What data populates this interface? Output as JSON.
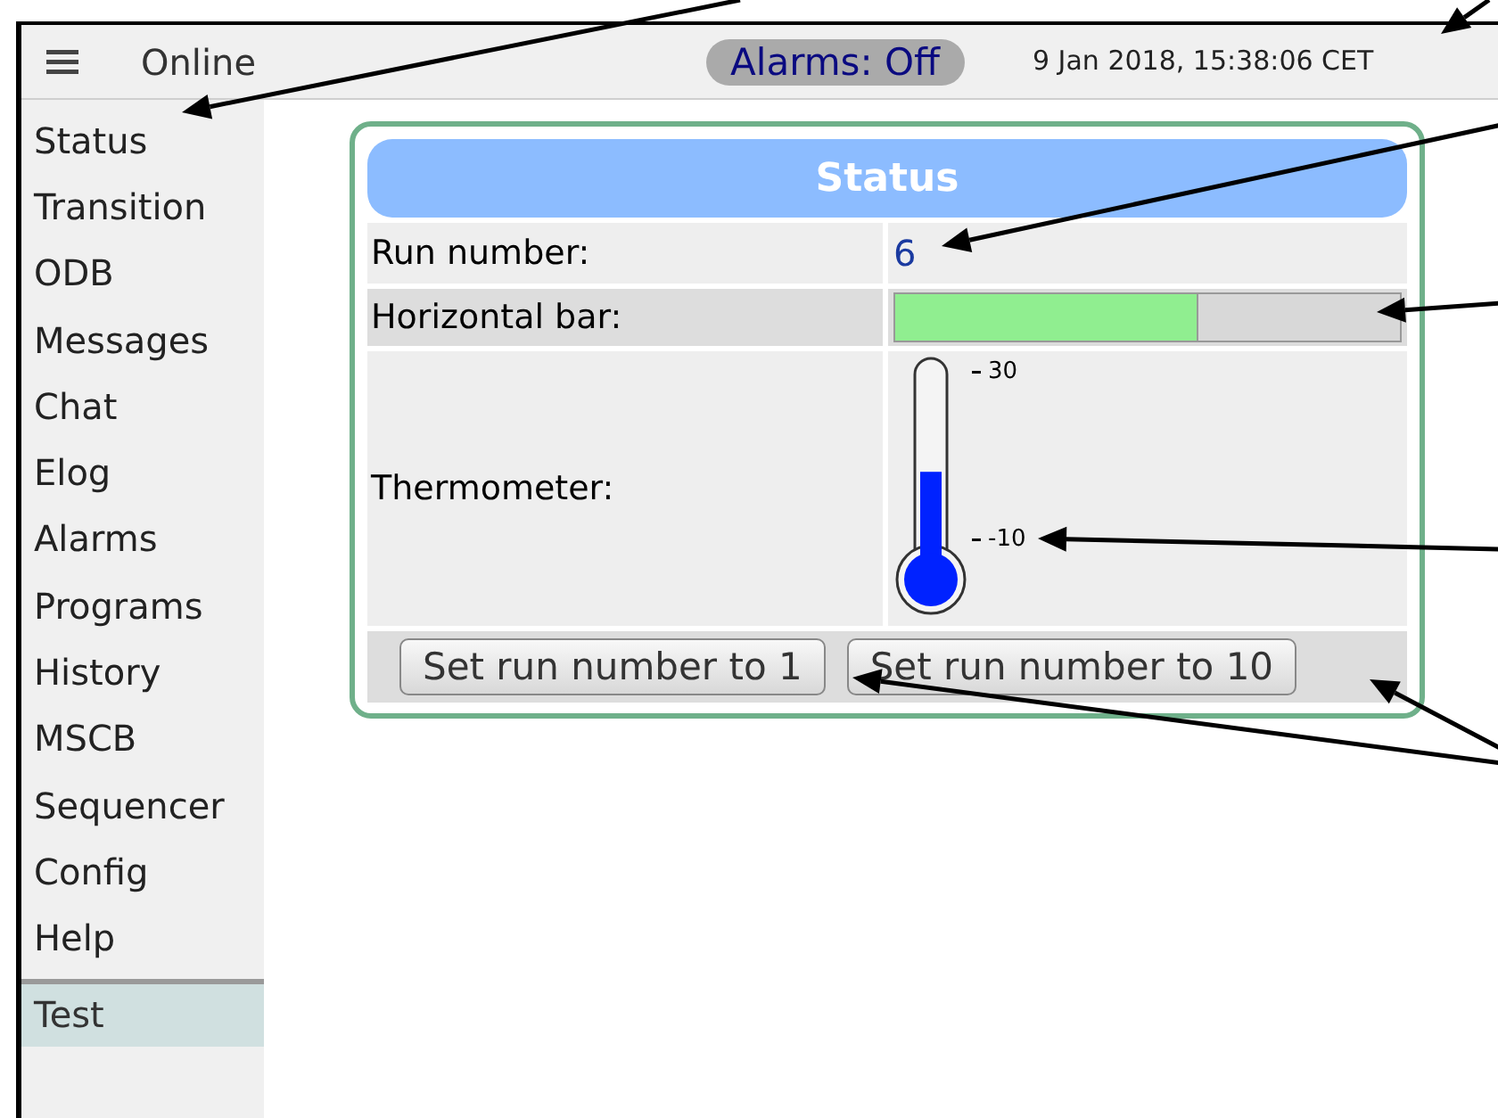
{
  "header": {
    "status": "Online",
    "alarms": "Alarms: Off",
    "datetime": "9 Jan 2018, 15:38:06 CET"
  },
  "sidebar": {
    "items": [
      {
        "label": "Status",
        "selected": false
      },
      {
        "label": "Transition",
        "selected": false
      },
      {
        "label": "ODB",
        "selected": false
      },
      {
        "label": "Messages",
        "selected": false
      },
      {
        "label": "Chat",
        "selected": false
      },
      {
        "label": "Elog",
        "selected": false
      },
      {
        "label": "Alarms",
        "selected": false
      },
      {
        "label": "Programs",
        "selected": false
      },
      {
        "label": "History",
        "selected": false
      },
      {
        "label": "MSCB",
        "selected": false
      },
      {
        "label": "Sequencer",
        "selected": false
      },
      {
        "label": "Config",
        "selected": false
      },
      {
        "label": "Help",
        "selected": false
      },
      {
        "label": "Test",
        "selected": true
      }
    ]
  },
  "panel": {
    "title": "Status",
    "rows": [
      {
        "kind": "text",
        "label": "Run number:",
        "value": "6"
      },
      {
        "kind": "bar",
        "label": "Horizontal bar:",
        "level": 0.6
      },
      {
        "kind": "thermometer",
        "label": "Thermometer:",
        "level": 0.4,
        "ticks": [
          "30",
          "-10"
        ]
      }
    ],
    "buttons": [
      "Set run number to 1",
      "Set run number to 10"
    ]
  }
}
